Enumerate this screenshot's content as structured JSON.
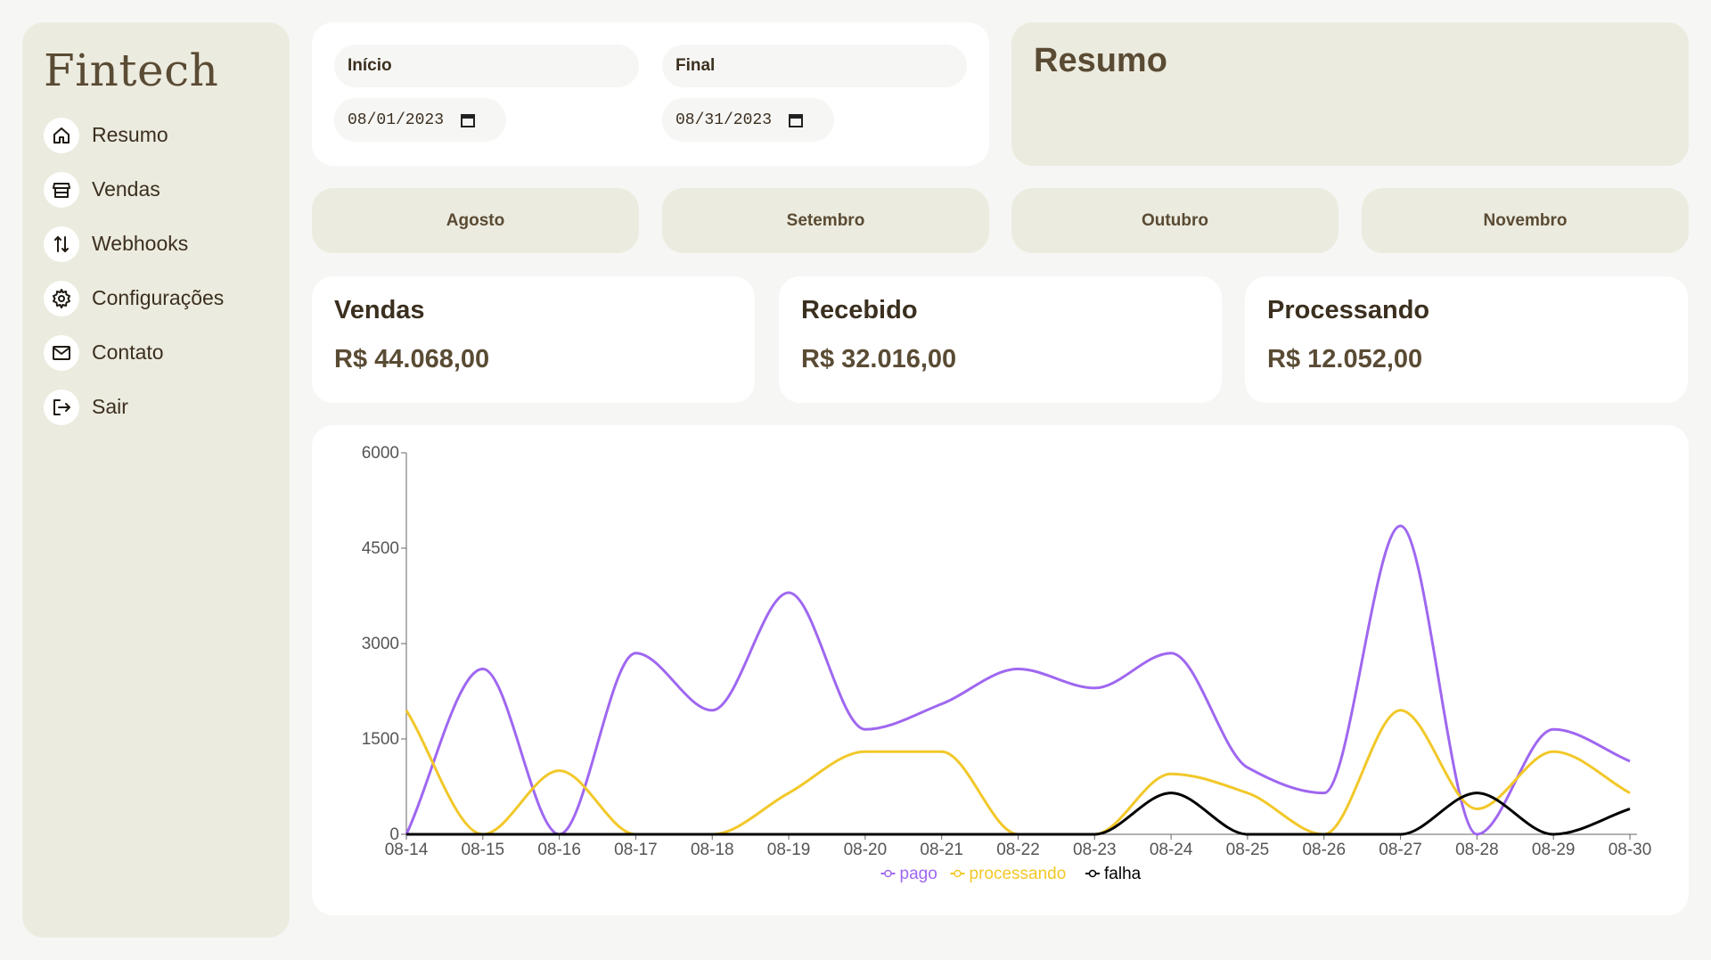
{
  "sidebar": {
    "logo": "Fintech",
    "items": [
      {
        "label": "Resumo",
        "icon": "home-icon"
      },
      {
        "label": "Vendas",
        "icon": "store-icon"
      },
      {
        "label": "Webhooks",
        "icon": "arrows-updown-icon"
      },
      {
        "label": "Configurações",
        "icon": "gear-icon"
      },
      {
        "label": "Contato",
        "icon": "mail-icon"
      },
      {
        "label": "Sair",
        "icon": "logout-icon"
      }
    ]
  },
  "dates": {
    "start": {
      "label": "Início",
      "value": "08/01/2023"
    },
    "end": {
      "label": "Final",
      "value": "08/31/2023"
    }
  },
  "summary": {
    "title": "Resumo"
  },
  "months": [
    "Agosto",
    "Setembro",
    "Outubro",
    "Novembro"
  ],
  "stats": [
    {
      "title": "Vendas",
      "value": "R$ 44.068,00"
    },
    {
      "title": "Recebido",
      "value": "R$ 32.016,00"
    },
    {
      "title": "Processando",
      "value": "R$ 12.052,00"
    }
  ],
  "chart_data": {
    "type": "line",
    "x": [
      "08-14",
      "08-15",
      "08-16",
      "08-17",
      "08-18",
      "08-19",
      "08-20",
      "08-21",
      "08-22",
      "08-23",
      "08-24",
      "08-25",
      "08-26",
      "08-27",
      "08-28",
      "08-29",
      "08-30"
    ],
    "ylim": [
      0,
      6000
    ],
    "yticks": [
      0,
      1500,
      3000,
      4500,
      6000
    ],
    "series": [
      {
        "name": "pago",
        "color": "#9f67f0",
        "values": [
          0,
          2600,
          0,
          2850,
          1950,
          3800,
          1650,
          2050,
          2600,
          2300,
          2850,
          1050,
          650,
          4850,
          0,
          1650,
          1150
        ]
      },
      {
        "name": "processando",
        "color": "#f2c829",
        "values": [
          1950,
          0,
          1000,
          0,
          0,
          650,
          1300,
          1300,
          0,
          0,
          950,
          650,
          0,
          1950,
          400,
          1300,
          650
        ]
      },
      {
        "name": "falha",
        "color": "#000000",
        "values": [
          0,
          0,
          0,
          0,
          0,
          0,
          0,
          0,
          0,
          0,
          650,
          0,
          0,
          0,
          650,
          0,
          400
        ]
      }
    ],
    "legend_position": "bottom-center"
  }
}
